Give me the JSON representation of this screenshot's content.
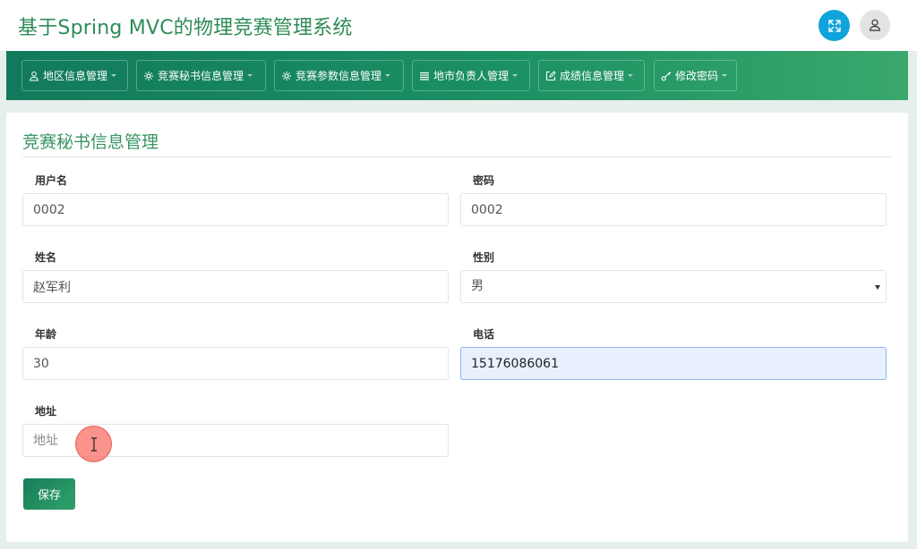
{
  "app": {
    "title": "基于Spring MVC的物理竞赛管理系统"
  },
  "header": {
    "fullscreen_icon": "expand-arrows-icon",
    "user_icon": "user-icon",
    "accent_color": "#11a3dc"
  },
  "nav": {
    "items": [
      {
        "label": "地区信息管理",
        "icon": "user-icon"
      },
      {
        "label": "竞赛秘书信息管理",
        "icon": "gear-icon"
      },
      {
        "label": "竞赛参数信息管理",
        "icon": "gear-icon"
      },
      {
        "label": "地市负责人管理",
        "icon": "list-icon"
      },
      {
        "label": "成绩信息管理",
        "icon": "edit-icon"
      },
      {
        "label": "修改密码",
        "icon": "key-icon"
      }
    ]
  },
  "form": {
    "title": "竞赛秘书信息管理",
    "username": {
      "label": "用户名",
      "value": "0002"
    },
    "password": {
      "label": "密码",
      "value": "0002"
    },
    "name": {
      "label": "姓名",
      "value": "赵军利"
    },
    "gender": {
      "label": "性别",
      "value": "男"
    },
    "age": {
      "label": "年龄",
      "value": "30"
    },
    "phone": {
      "label": "电话",
      "value": "15176086061"
    },
    "address": {
      "label": "地址",
      "placeholder": "地址"
    },
    "save_label": "保存"
  }
}
